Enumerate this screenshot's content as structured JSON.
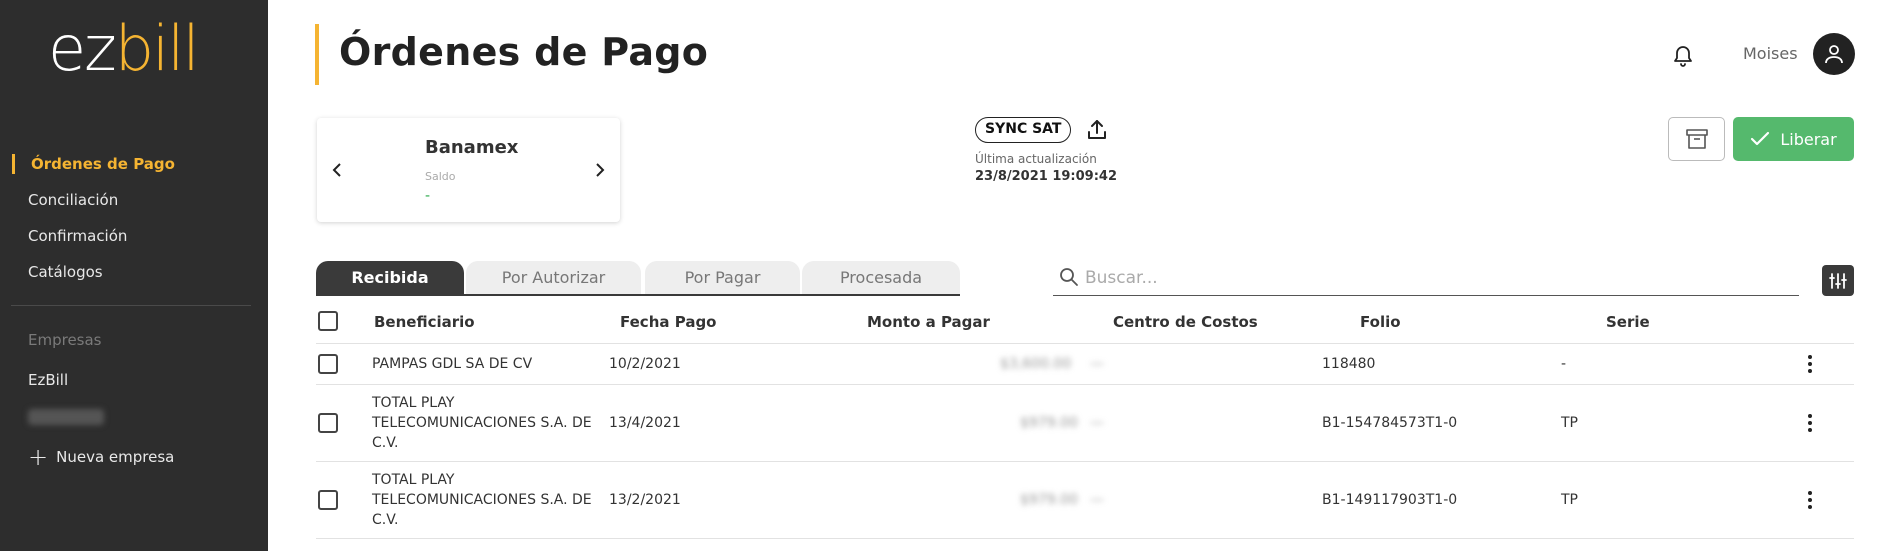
{
  "brand": {
    "logo_ez": "ez",
    "logo_bill": "bill",
    "accent": "#f5b432",
    "sidebar_bg": "#2d2d2d"
  },
  "sidebar": {
    "items": [
      {
        "label": "Órdenes de Pago",
        "active": true
      },
      {
        "label": "Conciliación"
      },
      {
        "label": "Confirmación"
      },
      {
        "label": "Catálogos"
      }
    ],
    "section_label": "Empresas",
    "company": "EzBill",
    "new_company": "Nueva empresa"
  },
  "header": {
    "title": "Órdenes de Pago",
    "username": "Moises"
  },
  "bank": {
    "name": "Banamex",
    "saldo_label": "Saldo",
    "saldo_value": "-"
  },
  "sync": {
    "label": "SYNC SAT",
    "last_update_label": "Última actualización",
    "last_update": "23/8/2021 19:09:42"
  },
  "actions": {
    "liberar_label": "Liberar",
    "liberar_color": "#55b96d"
  },
  "tabs": [
    {
      "label": "Recibida",
      "active": true
    },
    {
      "label": "Por Autorizar"
    },
    {
      "label": "Por Pagar"
    },
    {
      "label": "Procesada"
    }
  ],
  "search": {
    "placeholder": "Buscar..."
  },
  "table": {
    "columns": [
      "Beneficiario",
      "Fecha Pago",
      "Monto a Pagar",
      "Centro de Costos",
      "Folio",
      "Serie"
    ],
    "rows": [
      {
        "beneficiario": "PAMPAS GDL SA DE CV",
        "fecha": "10/2/2021",
        "monto": "$3,600.00",
        "centro": "—",
        "folio": "118480",
        "serie": "-"
      },
      {
        "beneficiario": "TOTAL PLAY TELECOMUNICACIONES S.A. DE C.V.",
        "fecha": "13/4/2021",
        "monto": "$979.00",
        "centro": "—",
        "folio": "B1-154784573T1-0",
        "serie": "TP"
      },
      {
        "beneficiario": "TOTAL PLAY TELECOMUNICACIONES S.A. DE C.V.",
        "fecha": "13/2/2021",
        "monto": "$979.00",
        "centro": "—",
        "folio": "B1-149117903T1-0",
        "serie": "TP"
      }
    ]
  }
}
